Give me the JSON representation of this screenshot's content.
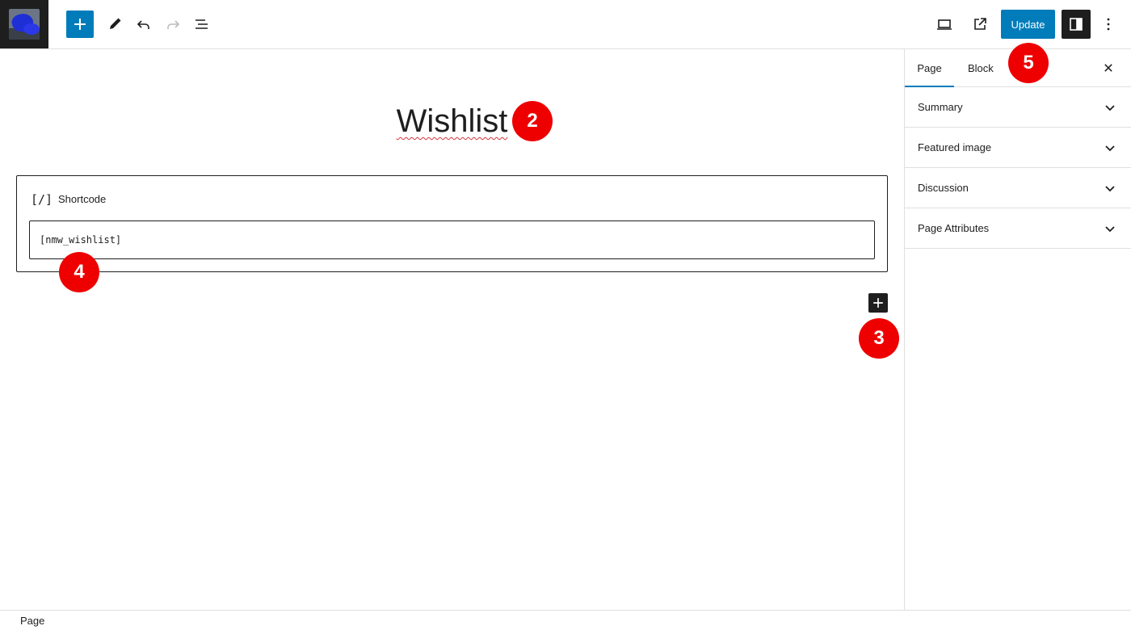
{
  "header": {
    "add_block_label": "Toggle block inserter",
    "update_label": "Update"
  },
  "icons": {
    "logo": "site-logo-icon",
    "add": "plus-icon",
    "tools": "pencil-icon",
    "undo": "undo-icon",
    "redo": "redo-icon",
    "list_view": "list-view-icon",
    "preview": "laptop-icon",
    "view_page": "external-link-icon",
    "settings": "sidebar-toggle-icon",
    "options": "more-vertical-icon",
    "close": "close-icon",
    "chevron": "chevron-down-icon"
  },
  "editor": {
    "title": "Wishlist",
    "block": {
      "icon_text": "[/]",
      "label": "Shortcode",
      "value": "[nmw_wishlist]"
    }
  },
  "sidebar": {
    "tabs": [
      "Page",
      "Block"
    ],
    "active_tab": "Page",
    "panels": [
      "Summary",
      "Featured image",
      "Discussion",
      "Page Attributes"
    ]
  },
  "footer": {
    "breadcrumb": "Page"
  },
  "markers": [
    "2",
    "3",
    "4",
    "5"
  ],
  "colors": {
    "accent": "#007cba",
    "marker": "#ee0000",
    "dark": "#1e1e1e"
  }
}
